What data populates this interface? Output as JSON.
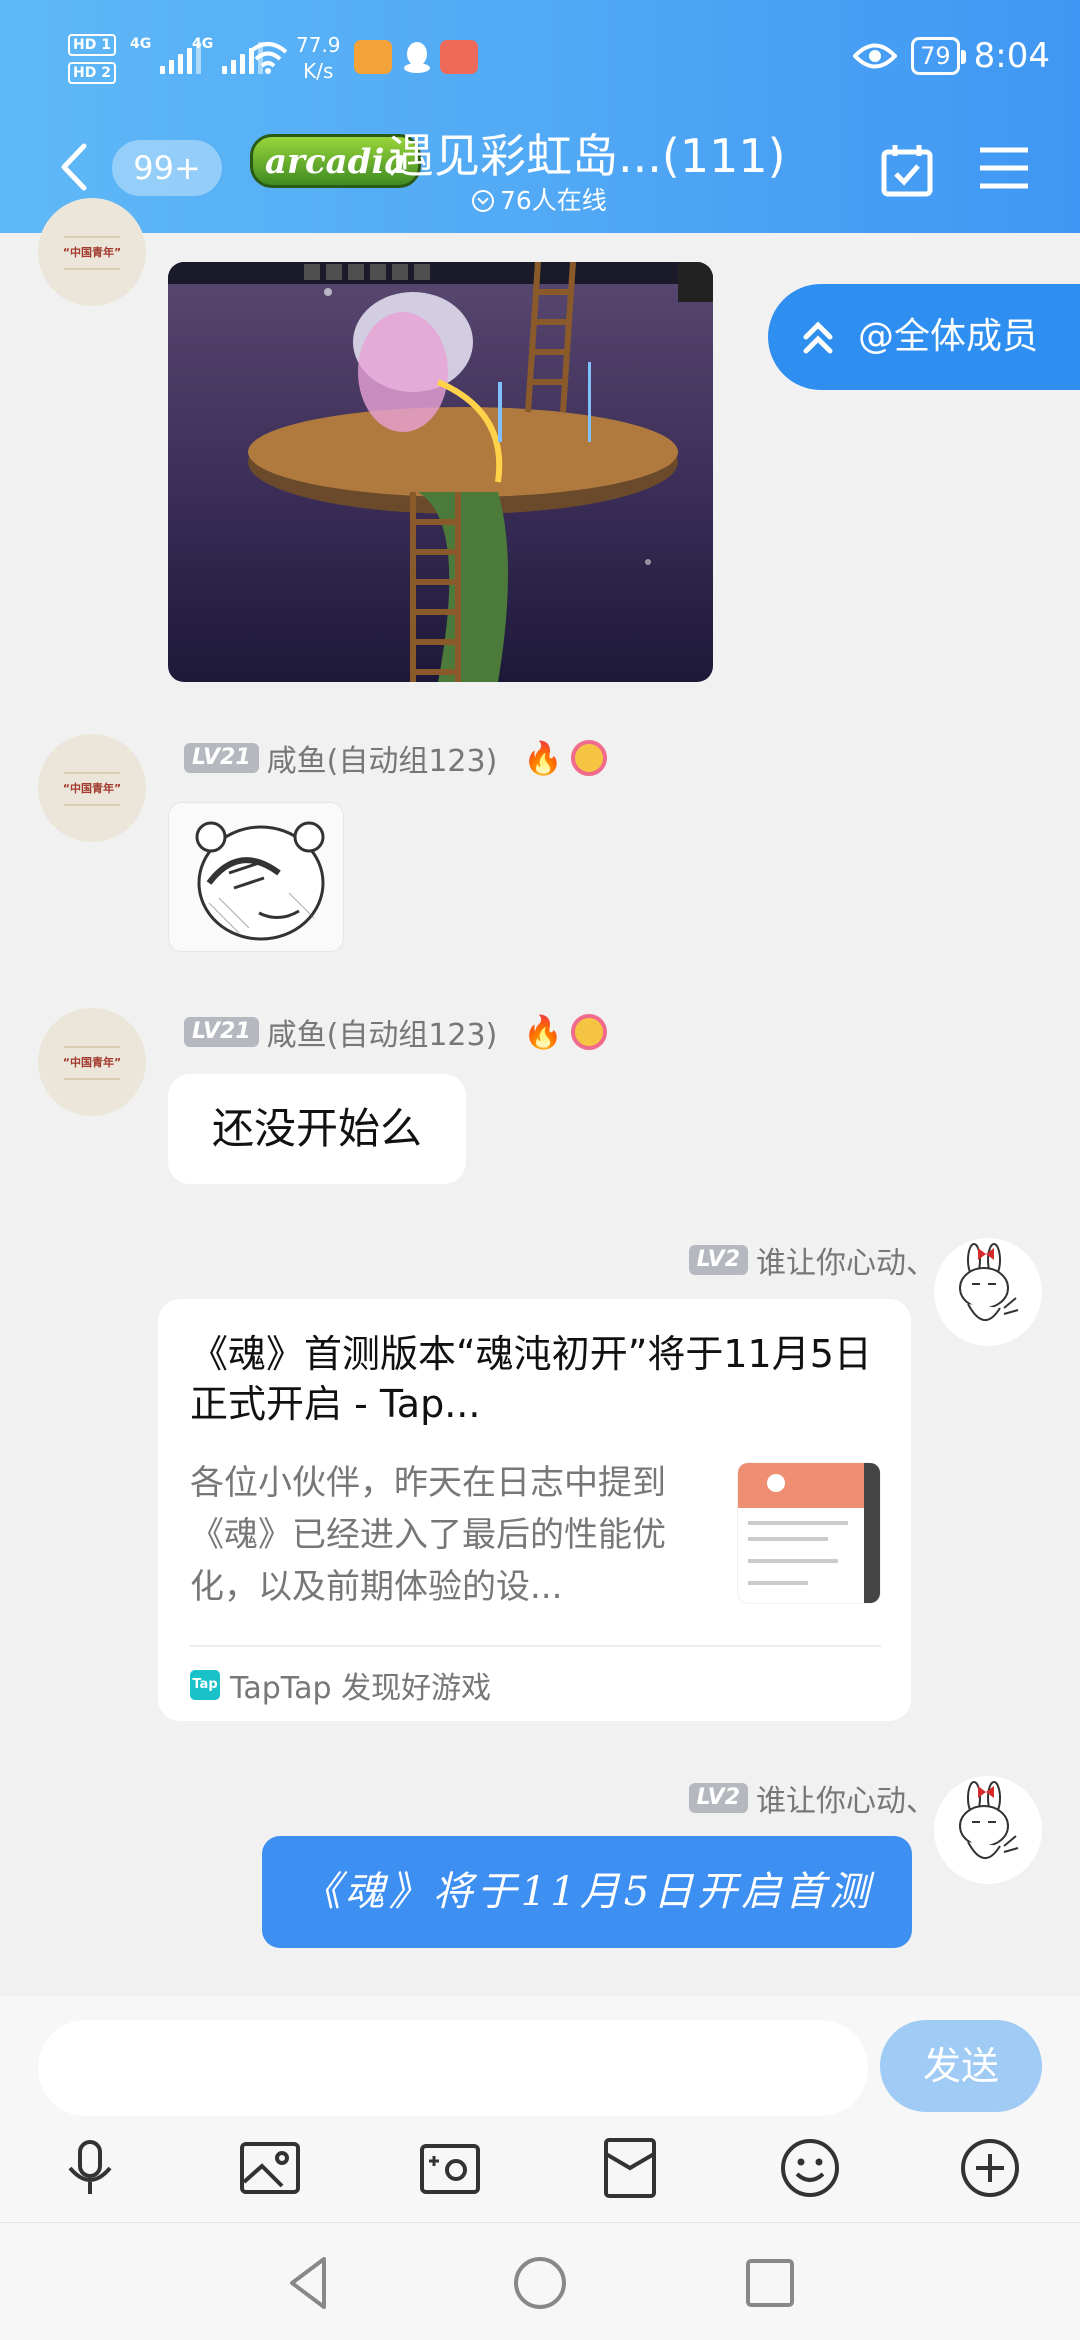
{
  "status_bar": {
    "hd1": "HD 1",
    "hd2": "HD 2",
    "net1": "4G",
    "net2": "4G",
    "speed_value": "77.9",
    "speed_unit": "K/s",
    "battery": "79",
    "time": "8:04"
  },
  "header": {
    "unread_count": "99+",
    "game_logo": "arcadia",
    "group_name": "遇见彩虹岛...(111)",
    "online": "76人在线"
  },
  "mention_button": {
    "label": "@全体成员"
  },
  "messages": [
    {
      "level": "LV21",
      "sender": "咸鱼(自动组123)",
      "type": "sticker"
    },
    {
      "level": "LV21",
      "sender": "咸鱼(自动组123)",
      "type": "text",
      "text": "还没开始么"
    },
    {
      "level": "LV2",
      "sender": "谁让你心动、",
      "type": "link_card",
      "card": {
        "title": "《魂》首测版本“魂沌初开”将于11月5日正式开启 - Tap...",
        "description": "各位小伙伴，昨天在日志中提到《魂》已经进入了最后的性能优化，以及前期体验的设...",
        "source_icon": "Tap",
        "source": "TapTap 发现好游戏"
      }
    },
    {
      "level": "LV2",
      "sender": "谁让你心动、",
      "type": "text",
      "text": "《魂》将于11月5日开启首测"
    }
  ],
  "avatar_text": "“中国青年”",
  "input": {
    "placeholder": "",
    "send_label": "发送"
  },
  "colors": {
    "header_start": "#5fb8f6",
    "header_end": "#3f97f3",
    "accent_blue": "#3d8ff2",
    "send_disabled": "#9fcbf5"
  }
}
